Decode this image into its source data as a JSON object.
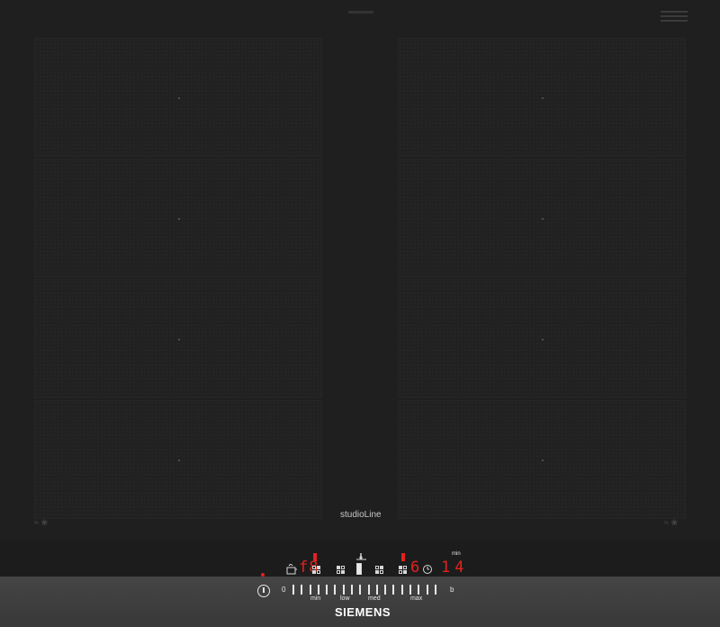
{
  "brand": "SIEMENS",
  "series_label": "studioLine",
  "colors": {
    "glass": "#1f1f1f",
    "indicator": "#e2221f",
    "strip": "#3e3e3e",
    "text": "#e6e6e6"
  },
  "zones_left": [
    {
      "name": "zone-left-1"
    },
    {
      "name": "zone-left-2"
    },
    {
      "name": "zone-left-3"
    },
    {
      "name": "zone-left-4"
    }
  ],
  "zones_right": [
    {
      "name": "zone-right-1"
    },
    {
      "name": "zone-right-2"
    },
    {
      "name": "zone-right-3"
    },
    {
      "name": "zone-right-4"
    }
  ],
  "display": {
    "left_power_level": "f8",
    "right_power_level": "6",
    "timer_value": "14",
    "timer_unit": "min"
  },
  "slider": {
    "zero": "0",
    "labels": [
      "min",
      "low",
      "med",
      "max"
    ],
    "boost": "b"
  },
  "icons": {
    "power": "power-icon",
    "pan": "pan-icon",
    "flex": "flex-zone-icon",
    "timer": "clock-icon",
    "fan": "ventilation-icon"
  }
}
